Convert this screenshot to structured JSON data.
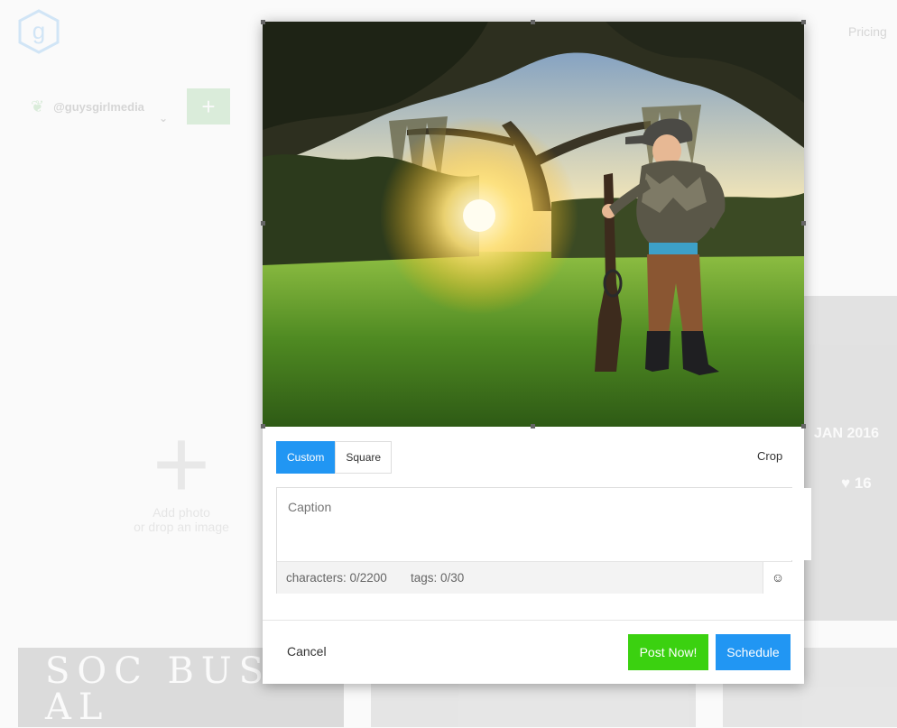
{
  "header": {
    "logo_letter": "g",
    "pricing_label": "Pricing"
  },
  "account": {
    "handle": "@guysgirlmedia",
    "add_label": "+"
  },
  "add_photo": {
    "plus": "+",
    "line1": "Add photo",
    "line2": "or drop an image"
  },
  "background_card": {
    "date_text": "JAN 2016",
    "likes": "16"
  },
  "background_tiles": {
    "doodle_text": "SOC BUSI AL"
  },
  "modal": {
    "crop_tabs": [
      "Custom",
      "Square"
    ],
    "crop_label": "Crop",
    "caption_placeholder": "Caption",
    "characters_label": "characters: 0/2200",
    "tags_label": "tags: 0/30",
    "emoji_icon": "☺",
    "cancel_label": "Cancel",
    "post_now_label": "Post Now!",
    "schedule_label": "Schedule"
  },
  "colors": {
    "accent_blue": "#2196f3",
    "post_green": "#3bd110"
  }
}
